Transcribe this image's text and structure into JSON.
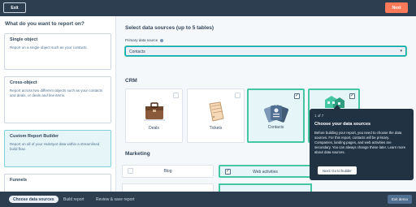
{
  "topbar": {
    "exit_label": "Exit",
    "next_label": "Next"
  },
  "left": {
    "heading": "What do you want to report on?",
    "options": [
      {
        "title": "Single object",
        "desc": "Report on a single object such as your contacts."
      },
      {
        "title": "Cross-object",
        "desc": "Report across two different objects such as your contacts and deals, or deals and line items."
      },
      {
        "title": "Custom Report Builder",
        "desc": "Report on all of your HubSpot data within a streamlined build flow."
      },
      {
        "title": "Funnels",
        "desc": ""
      }
    ]
  },
  "main": {
    "heading": "Select data sources (up to 5 tables)",
    "primary_label": "Primary data source",
    "primary_value": "Contacts",
    "crm_label": "CRM",
    "crm_tiles": [
      {
        "label": "Deals",
        "checked": false,
        "icon": "briefcase-icon"
      },
      {
        "label": "Tickets",
        "checked": false,
        "icon": "ticket-icon"
      },
      {
        "label": "Contacts",
        "checked": true,
        "icon": "contacts-cards-icon"
      },
      {
        "label": "",
        "checked": true,
        "icon": "company-building-icon"
      }
    ],
    "marketing_label": "Marketing",
    "marketing_tiles": [
      {
        "label": "Blog",
        "checked": false
      },
      {
        "label": "Web activities",
        "checked": true
      }
    ]
  },
  "tooltip": {
    "step": "1 of 7",
    "title": "Choose your data sources",
    "body": "Before building your report, you need to choose the data sources. For this report, contacts will be primary. Companies, landing pages, and web activities are secondary. You can always change these later. Learn more about data sources.",
    "button": "Next: Go to builder"
  },
  "bottombar": {
    "steps": [
      "Choose data sources",
      "Build report",
      "Review & save report"
    ],
    "exit_demo": "Exit demo"
  },
  "colors": {
    "accent": "#ff7a59",
    "teal": "#45c6a2",
    "navy": "#2d3e50",
    "tooltip": "#213343"
  }
}
